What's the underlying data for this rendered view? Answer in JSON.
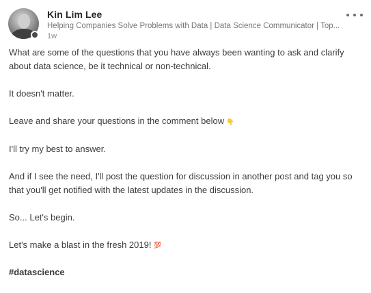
{
  "author": {
    "name": "Kin Lim Lee",
    "headline": "Helping Companies Solve Problems with Data | Data Science Communicator | Top...",
    "time": "1w"
  },
  "post": {
    "paragraphs": [
      "What are some of the questions that you have always been wanting to ask and clarify about data science, be it technical or non-technical.",
      "It doesn't matter.",
      "Leave and share your questions in the comment below",
      "I'll try my best to answer.",
      "And if I see the need, I'll post the question for discussion in another post and tag you so that you'll get notified with the latest updates in the discussion.",
      "So... Let's begin.",
      "Let's make a blast in the fresh 2019!"
    ],
    "emoji_point_down": "👇",
    "emoji_hundred": "💯",
    "hashtag": "#datascience"
  },
  "icons": {
    "more": "more-horizontal-icon",
    "presence": "presence-indicator-icon"
  }
}
